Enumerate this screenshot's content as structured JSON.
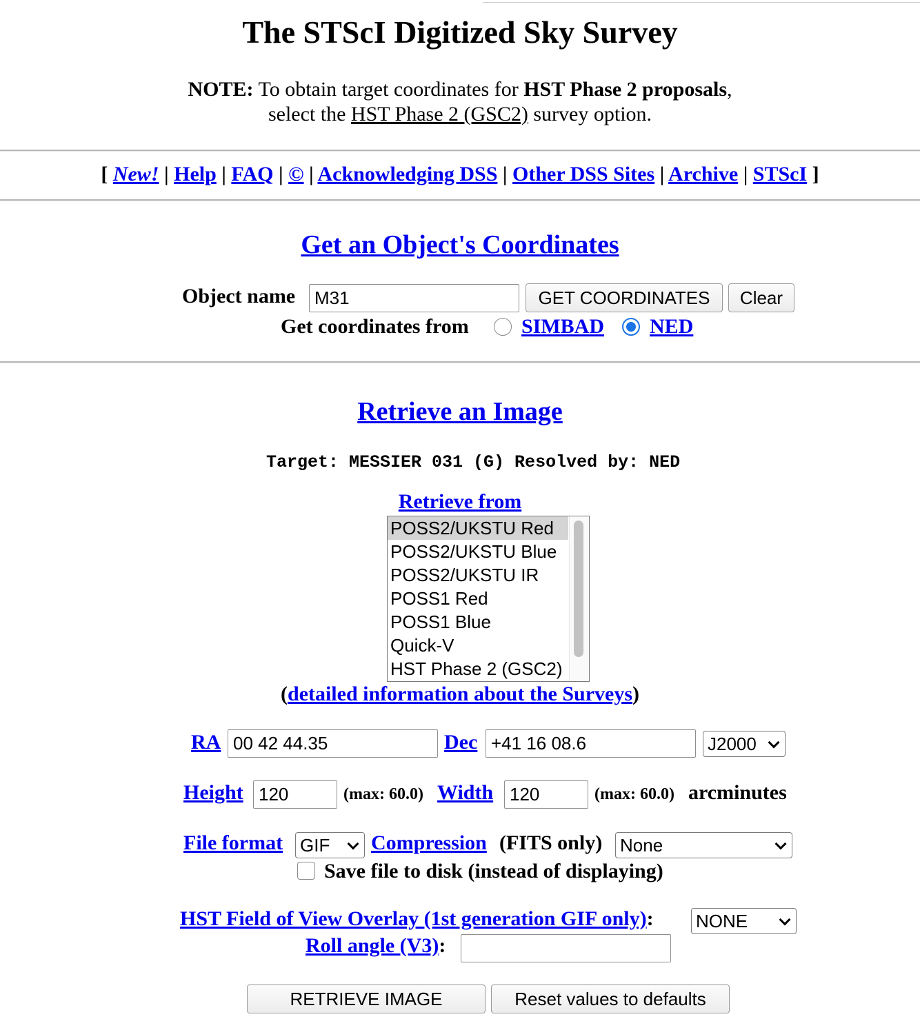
{
  "page": {
    "title": "The STScI Digitized Sky Survey"
  },
  "note": {
    "label": "NOTE:",
    "text1": " To obtain target coordinates for ",
    "bold": "HST Phase 2 proposals",
    "text2": ",",
    "line2_pre": "select the ",
    "link": "HST Phase 2 (GSC2)",
    "line2_post": " survey option."
  },
  "nav": {
    "open": "[ ",
    "close": " ]",
    "sep": " | ",
    "items": [
      "New!",
      "Help",
      "FAQ",
      "©",
      "Acknowledging DSS",
      "Other DSS Sites",
      "Archive",
      "STScI"
    ]
  },
  "coords": {
    "heading": "Get an Object's Coordinates",
    "object_label": "Object name",
    "object_value": "M31",
    "get_button": "GET COORDINATES",
    "clear_button": "Clear",
    "from_label": "Get coordinates from",
    "sources": [
      {
        "label": "SIMBAD",
        "checked": false
      },
      {
        "label": "NED",
        "checked": true
      }
    ]
  },
  "retrieve": {
    "heading": "Retrieve an Image",
    "target_line": "Target: MESSIER 031 (G)      Resolved by: NED",
    "from_heading": "Retrieve from",
    "surveys": [
      {
        "label": "POSS2/UKSTU Red",
        "selected": true
      },
      {
        "label": "POSS2/UKSTU Blue",
        "selected": false
      },
      {
        "label": "POSS2/UKSTU IR",
        "selected": false
      },
      {
        "label": "POSS1 Red",
        "selected": false
      },
      {
        "label": "POSS1 Blue",
        "selected": false
      },
      {
        "label": "Quick-V",
        "selected": false
      },
      {
        "label": "HST Phase 2 (GSC2)",
        "selected": false
      }
    ],
    "survey_info_open": "(",
    "survey_info_link": "detailed information about the Surveys",
    "survey_info_close": ")",
    "ra_label": "RA",
    "ra_value": "00 42 44.35",
    "dec_label": "Dec",
    "dec_value": "+41 16 08.6",
    "equinox": "J2000",
    "height_label": "Height",
    "height_value": "120",
    "height_max": "(max: 60.0)",
    "width_label": "Width",
    "width_value": "120",
    "width_max": "(max: 60.0)",
    "units": "arcminutes",
    "format_label": "File format",
    "format_value": "GIF",
    "compression_label": "Compression",
    "compression_note": "(FITS only)",
    "compression_value": "None",
    "save_label": "Save file to disk (instead of displaying)",
    "save_checked": false,
    "overlay_label": "HST Field of View Overlay (1st generation GIF only)",
    "overlay_colon": ":",
    "overlay_value": "NONE",
    "roll_label": "Roll angle (V3)",
    "roll_colon": ":",
    "roll_value": "",
    "retrieve_button": "RETRIEVE IMAGE",
    "reset_button": "Reset values to defaults"
  }
}
